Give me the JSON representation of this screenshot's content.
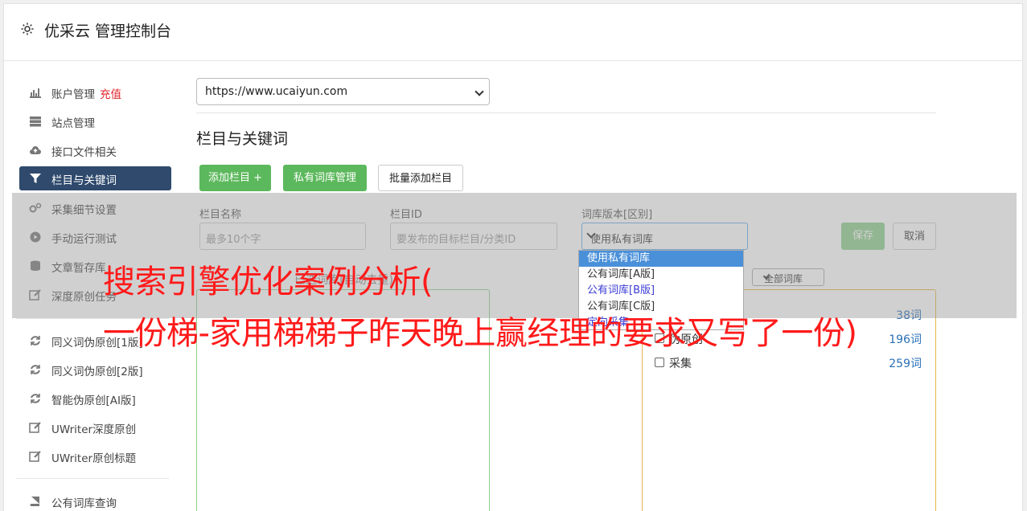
{
  "app": {
    "title": "优采云 管理控制台"
  },
  "sidebar": {
    "items": [
      {
        "label": "账户管理",
        "badge": "充值",
        "icon": "bar-chart-icon"
      },
      {
        "label": "站点管理",
        "icon": "server-icon"
      },
      {
        "label": "接口文件相关",
        "icon": "cloud-upload-icon"
      },
      {
        "label": "栏目与关键词",
        "icon": "filter-icon",
        "active": true
      },
      {
        "label": "采集细节设置",
        "icon": "cogs-icon"
      },
      {
        "label": "手动运行测试",
        "icon": "play-circle-icon"
      },
      {
        "label": "文章暂存库",
        "icon": "database-icon"
      },
      {
        "label": "深度原创任务",
        "icon": "edit-icon"
      },
      {
        "label": "同义词伪原创[1版]",
        "icon": "refresh-icon"
      },
      {
        "label": "同义词伪原创[2版]",
        "icon": "refresh-icon"
      },
      {
        "label": "智能伪原创[AI版]",
        "icon": "refresh-icon"
      },
      {
        "label": "UWriter深度原创",
        "icon": "edit-icon"
      },
      {
        "label": "UWriter原创标题",
        "icon": "edit-icon"
      },
      {
        "label": "公有词库查询",
        "icon": "book-icon"
      }
    ]
  },
  "main": {
    "site_select": "https://www.ucaiyun.com",
    "section_title": "栏目与关键词",
    "buttons": {
      "add_column": "添加栏目 +",
      "private_lib": "私有词库管理",
      "batch_add": "批量添加栏目"
    },
    "form": {
      "name_label": "栏目名称",
      "name_placeholder": "最多10个字",
      "id_label": "栏目ID",
      "id_placeholder": "要发布的目标栏目/分类ID",
      "version_label": "词库版本[区别]",
      "version_value": "使用私有词库",
      "save": "保存",
      "cancel": "取消"
    },
    "version_options": [
      "使用私有词库",
      "公有词库[A版]",
      "公有词库[B版]",
      "公有词库[C版]",
      "定向采集"
    ],
    "left_box_label": "已选词库(自动去重)",
    "all_libs_select": "全部词库",
    "libraries": [
      {
        "name": "",
        "count": "38词"
      },
      {
        "name": "伪原创",
        "count": "196词"
      },
      {
        "name": "采集",
        "count": "259词"
      }
    ]
  },
  "banner": {
    "line1": "搜索引擎优化案例分析(",
    "line2": "一份梯-家用梯梯子昨天晚上赢经理的要求又写了一份)"
  }
}
